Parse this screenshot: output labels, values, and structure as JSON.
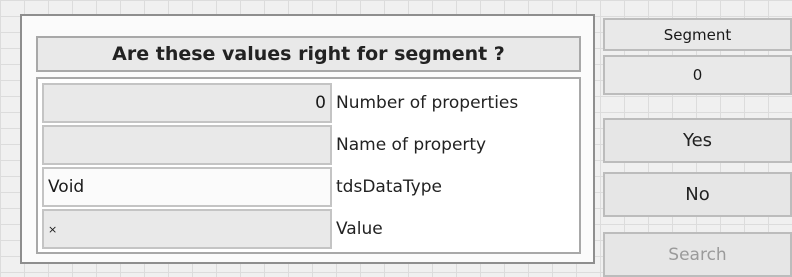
{
  "dialog": {
    "title": "Are these values right for segment ?",
    "properties": [
      {
        "value": "0",
        "label": "Number of properties"
      },
      {
        "value": "",
        "label": "Name of property"
      },
      {
        "value": "Void",
        "label": "tdsDataType"
      },
      {
        "value": "×",
        "label": "Value"
      }
    ]
  },
  "segment": {
    "header": "Segment",
    "value": "0"
  },
  "buttons": {
    "yes": "Yes",
    "no": "No",
    "search": "Search"
  }
}
